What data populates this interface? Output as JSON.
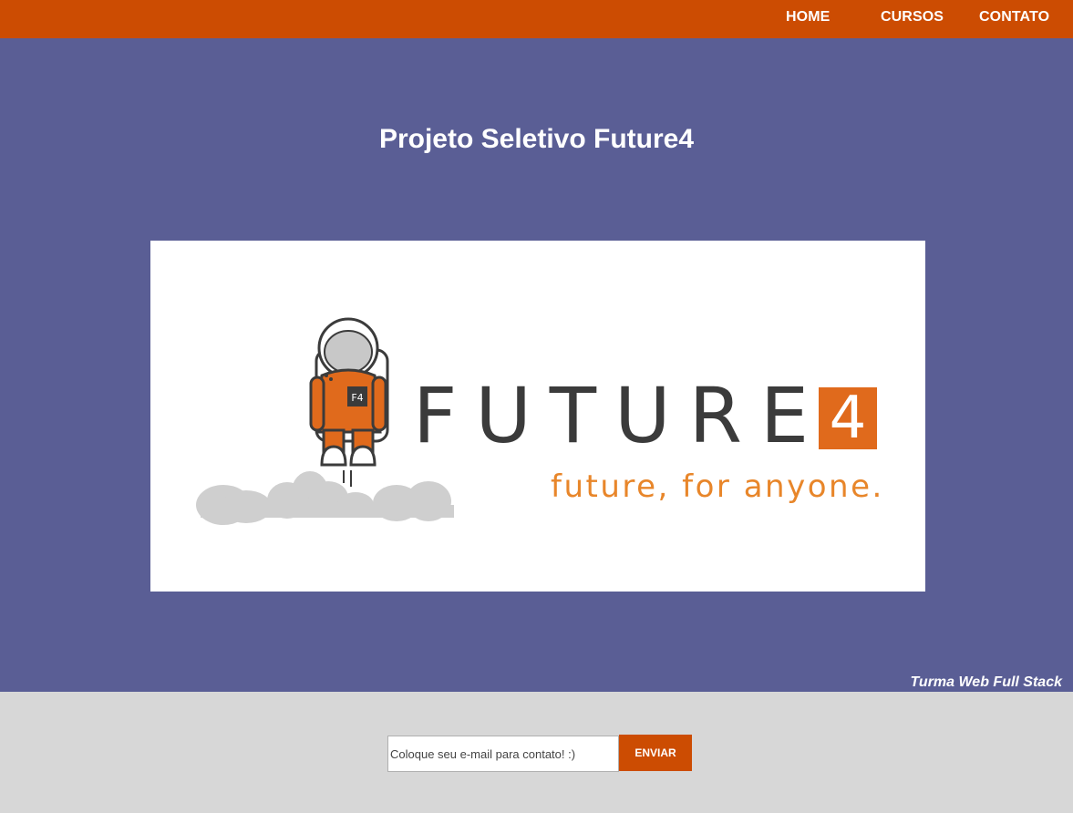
{
  "nav": {
    "items": [
      {
        "label": "HOME"
      },
      {
        "label": "CURSOS"
      },
      {
        "label": "CONTATO"
      }
    ]
  },
  "hero": {
    "title": "Projeto Seletivo Future4",
    "logo": {
      "word": "FUTURE",
      "number": "4",
      "tagline": "future, for anyone.",
      "badge": "F4",
      "colors": {
        "orange": "#e06a1c",
        "text": "#3b3b3b",
        "tagline": "#e8862a"
      }
    },
    "turma": "Turma Web Full Stack"
  },
  "contact": {
    "placeholder": "Coloque seu e-mail para contato! :)",
    "button": "ENVIAR"
  },
  "colors": {
    "topbar": "#cc4c02",
    "hero_bg": "#5a5e95",
    "footer_bg": "#d7d7d7",
    "button": "#cc4c02"
  }
}
